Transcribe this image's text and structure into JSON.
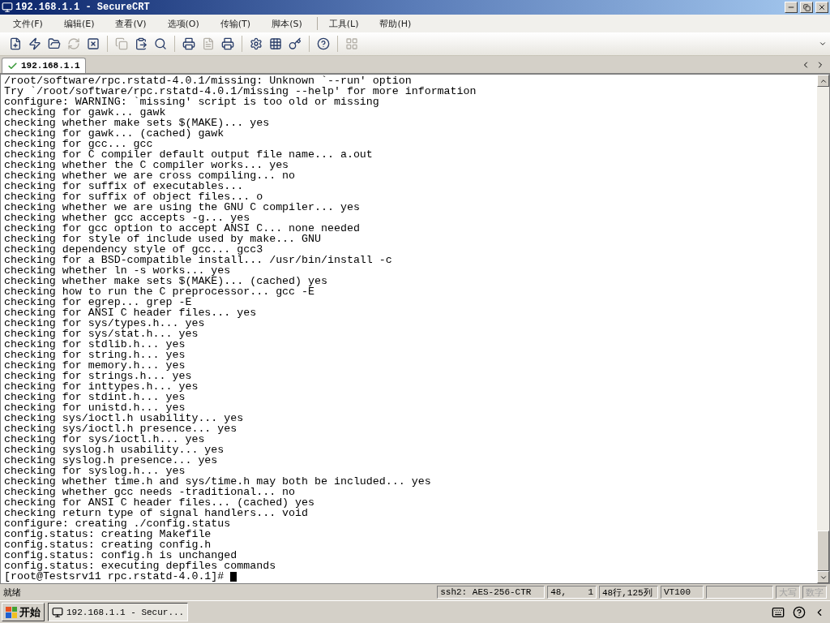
{
  "window": {
    "title": "192.168.1.1 - SecureCRT"
  },
  "menu": [
    [
      "文件(F)",
      "编辑(E)",
      "查看(V)",
      "选项(O)",
      "传输(T)",
      "脚本(S)"
    ],
    [
      "工具(L)",
      "帮助(H)"
    ]
  ],
  "toolbar": [
    [
      {
        "disabled": false
      },
      {
        "disabled": false
      },
      {
        "disabled": false
      },
      {
        "disabled": true
      },
      {
        "disabled": false
      }
    ],
    [
      {
        "disabled": true
      },
      {
        "disabled": false
      },
      {
        "disabled": false
      }
    ],
    [
      {
        "disabled": false
      },
      {
        "disabled": true
      },
      {
        "disabled": false
      }
    ],
    [
      {
        "disabled": false
      },
      {
        "disabled": false
      },
      {
        "disabled": false
      }
    ],
    [
      {
        "disabled": false
      }
    ],
    [
      {
        "disabled": true
      }
    ]
  ],
  "tabs": [
    {
      "label": "192.168.1.1",
      "selected": true,
      "connected": true
    }
  ],
  "terminal": {
    "lines": [
      "/root/software/rpc.rstatd-4.0.1/missing: Unknown `--run' option",
      "Try `/root/software/rpc.rstatd-4.0.1/missing --help' for more information",
      "configure: WARNING: `missing' script is too old or missing",
      "checking for gawk... gawk",
      "checking whether make sets $(MAKE)... yes",
      "checking for gawk... (cached) gawk",
      "checking for gcc... gcc",
      "checking for C compiler default output file name... a.out",
      "checking whether the C compiler works... yes",
      "checking whether we are cross compiling... no",
      "checking for suffix of executables... ",
      "checking for suffix of object files... o",
      "checking whether we are using the GNU C compiler... yes",
      "checking whether gcc accepts -g... yes",
      "checking for gcc option to accept ANSI C... none needed",
      "checking for style of include used by make... GNU",
      "checking dependency style of gcc... gcc3",
      "checking for a BSD-compatible install... /usr/bin/install -c",
      "checking whether ln -s works... yes",
      "checking whether make sets $(MAKE)... (cached) yes",
      "checking how to run the C preprocessor... gcc -E",
      "checking for egrep... grep -E",
      "checking for ANSI C header files... yes",
      "checking for sys/types.h... yes",
      "checking for sys/stat.h... yes",
      "checking for stdlib.h... yes",
      "checking for string.h... yes",
      "checking for memory.h... yes",
      "checking for strings.h... yes",
      "checking for inttypes.h... yes",
      "checking for stdint.h... yes",
      "checking for unistd.h... yes",
      "checking sys/ioctl.h usability... yes",
      "checking sys/ioctl.h presence... yes",
      "checking for sys/ioctl.h... yes",
      "checking syslog.h usability... yes",
      "checking syslog.h presence... yes",
      "checking for syslog.h... yes",
      "checking whether time.h and sys/time.h may both be included... yes",
      "checking whether gcc needs -traditional... no",
      "checking for ANSI C header files... (cached) yes",
      "checking return type of signal handlers... void",
      "configure: creating ./config.status",
      "config.status: creating Makefile",
      "config.status: creating config.h",
      "config.status: config.h is unchanged",
      "config.status: executing depfiles commands"
    ],
    "prompt": "[root@Testsrv11 rpc.rstatd-4.0.1]# "
  },
  "status_bar": {
    "message": "就绪",
    "fields": [
      {
        "kind": "text",
        "text": "ssh2: AES-256-CTR",
        "disabled": false
      },
      {
        "kind": "text",
        "text": "48,    1",
        "disabled": false
      },
      {
        "kind": "text",
        "text": "48行,125列",
        "disabled": false
      },
      {
        "kind": "text",
        "text": "VT100",
        "disabled": false
      },
      {
        "kind": "blank"
      },
      {
        "kind": "text",
        "text": "大写",
        "disabled": true
      },
      {
        "kind": "text",
        "text": "数字",
        "disabled": true
      }
    ]
  },
  "taskbar": {
    "start": "开始",
    "tasks": [
      {
        "label": "192.168.1.1 - Secur...",
        "selected": true
      }
    ]
  }
}
